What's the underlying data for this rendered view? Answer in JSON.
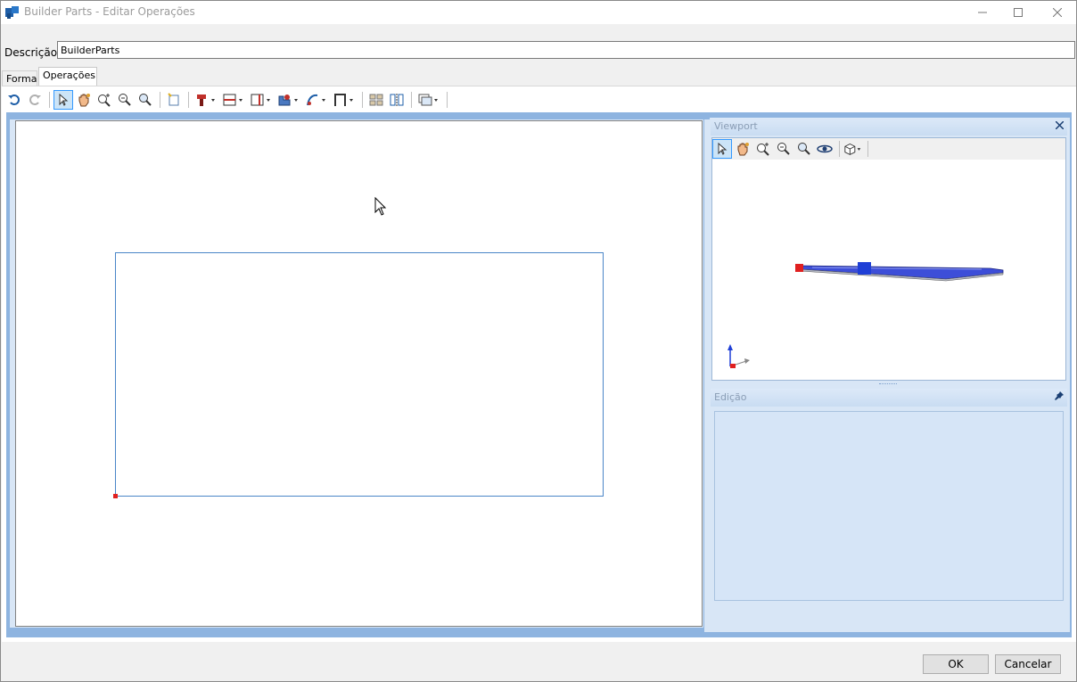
{
  "window": {
    "title": "Builder Parts - Editar Operações",
    "minimize_icon": "minimize-icon",
    "maximize_icon": "maximize-icon",
    "close_icon": "close-icon"
  },
  "description": {
    "label": "Descrição",
    "value": "BuilderParts"
  },
  "tabs": [
    {
      "label": "Forma",
      "selected": false
    },
    {
      "label": "Operações",
      "selected": true
    }
  ],
  "toolbar": {
    "icons": [
      "undo-icon",
      "redo-icon",
      "select-pointer-icon",
      "pan-hand-icon",
      "zoom-window-icon",
      "zoom-in-out-icon",
      "zoom-extents-icon",
      "new-note-icon",
      "drill-tool-icon",
      "horizontal-section-icon",
      "vertical-section-icon",
      "profile-tool-icon",
      "path-tool-icon",
      "frame-tool-icon",
      "array-grid-icon",
      "mirror-icon",
      "view-options-icon"
    ]
  },
  "viewport_panel": {
    "title": "Viewport",
    "toolbar_icons": [
      "select-pointer-icon",
      "pan-hand-icon",
      "zoom-window-icon",
      "zoom-in-out-icon",
      "zoom-extents-icon",
      "orbit-icon",
      "view-cube-icon"
    ]
  },
  "edit_panel": {
    "title": "Edição"
  },
  "buttons": {
    "ok": "OK",
    "cancel": "Cancelar"
  },
  "colors": {
    "frame_blue": "#8eb4e0",
    "panel_blue": "#d6e5f7",
    "origin_red": "#e02020",
    "shape_blue": "#1f3fd6"
  }
}
